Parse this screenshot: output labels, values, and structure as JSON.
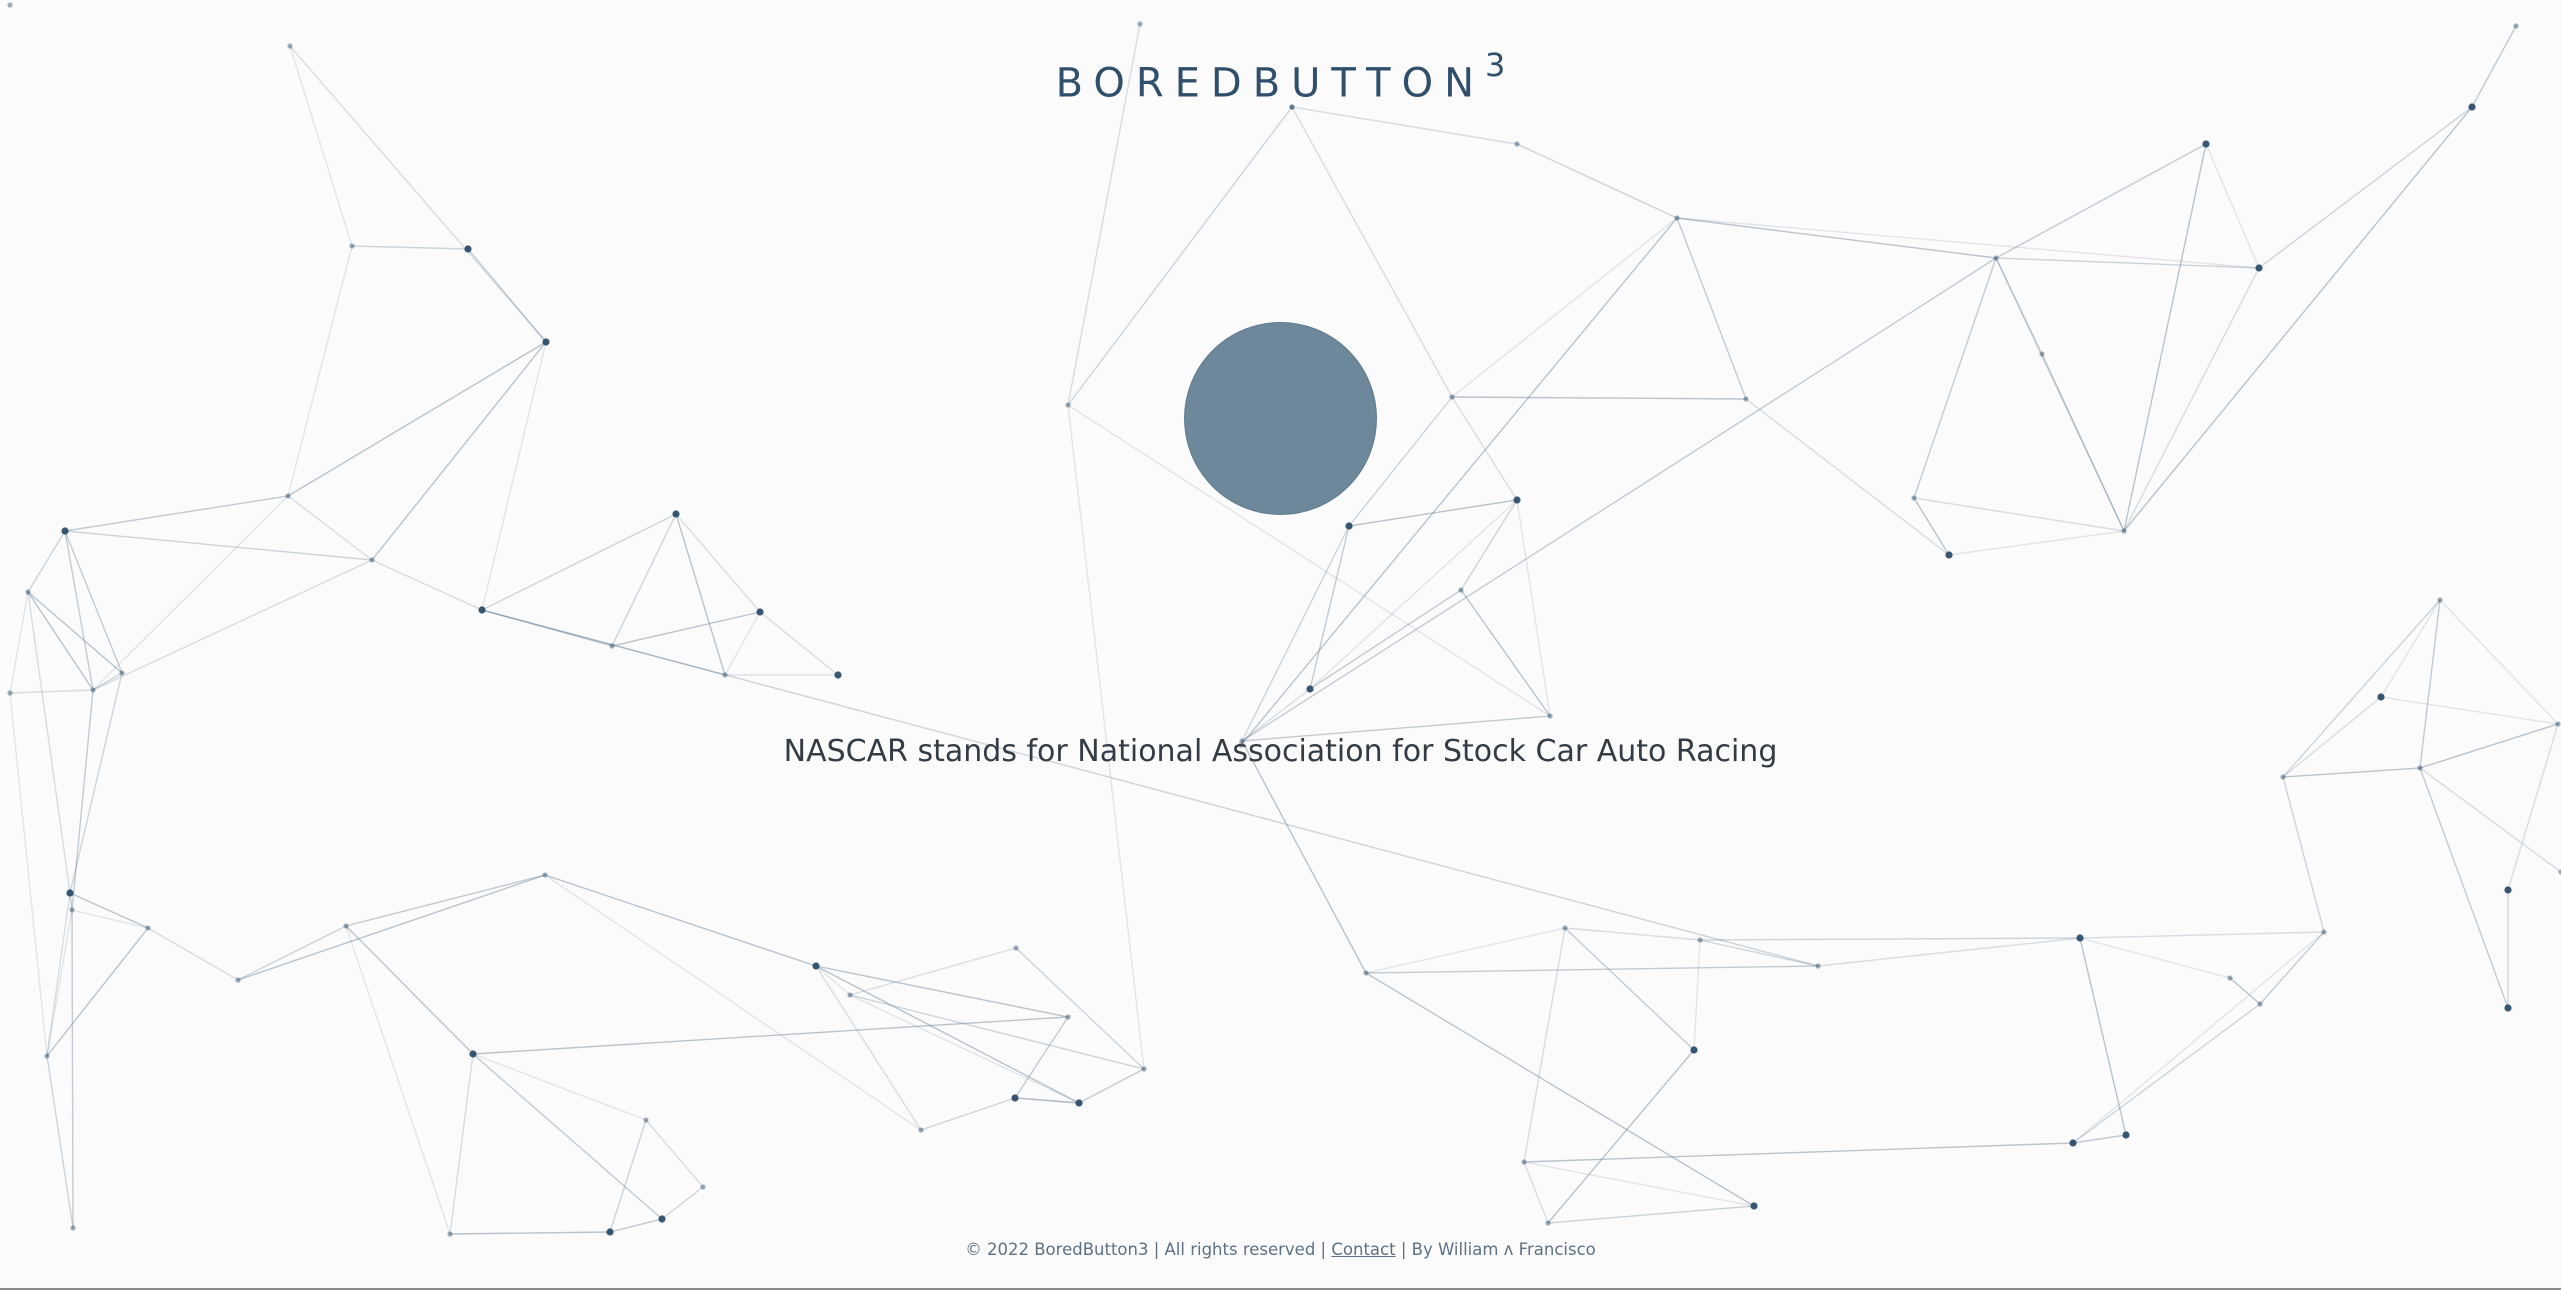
{
  "header": {
    "logo_text": "BOREDBUTTON",
    "logo_superscript": "3"
  },
  "main": {
    "button": {
      "color": "#6e889b"
    },
    "fact_text": "NASCAR stands for National Association for Stock Car Auto Racing"
  },
  "footer": {
    "copyright": "© 2022 BoredButton3 | All rights reserved | ",
    "contact_link": "Contact",
    "byline": " | By William ʌ Francisco"
  },
  "colors": {
    "background": "#fbfbfb",
    "accent": "#2f4f6c",
    "node": "#2e4e6b",
    "edge": "#6a8299"
  }
}
